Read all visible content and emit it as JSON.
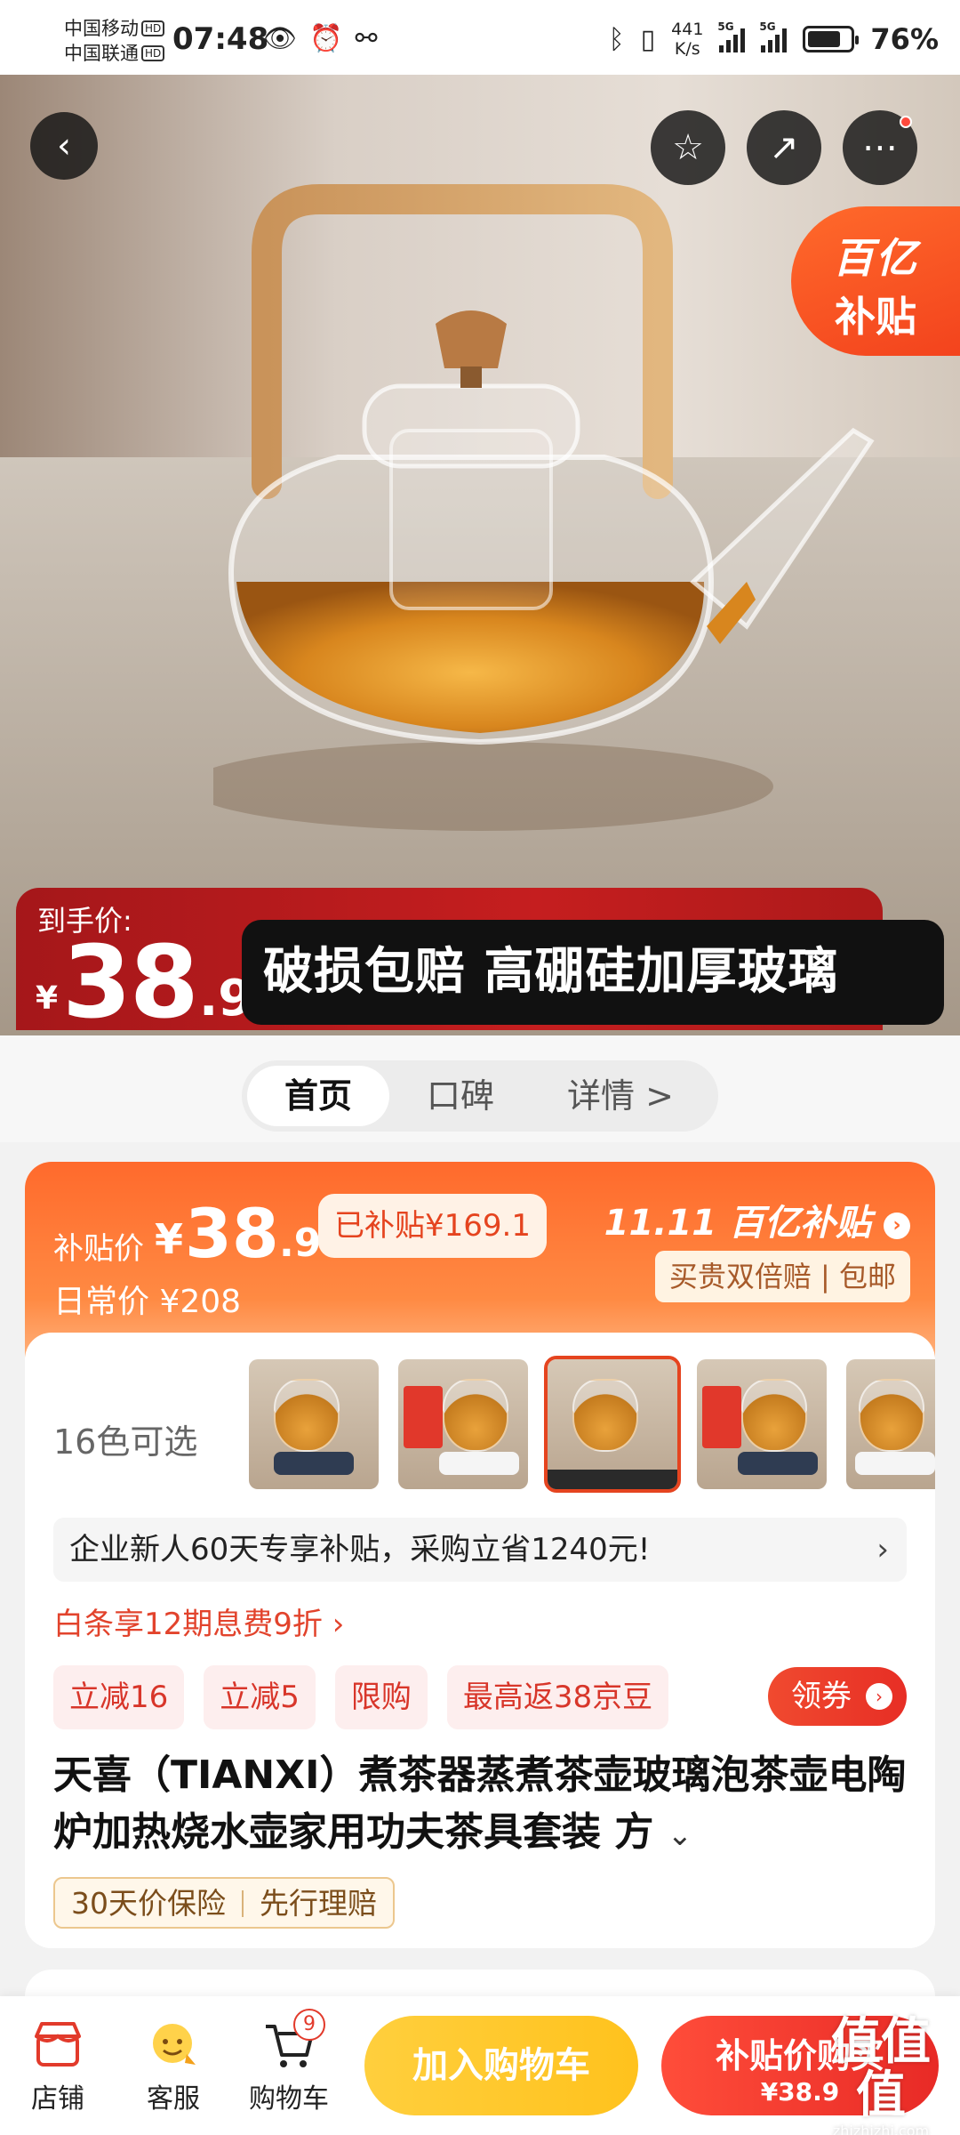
{
  "status_bar": {
    "carrier1": "中国移动",
    "carrier2": "中国联通",
    "hd": "HD",
    "time": "07:48",
    "net_speed_value": "441",
    "net_speed_unit": "K/s",
    "sig_tag": "5G",
    "battery_pct": "76%"
  },
  "hero": {
    "badge_line1": "百亿",
    "badge_line2": "补贴",
    "price_label": "到手价:",
    "price_yen": "¥",
    "price_int": "38",
    "price_dec": ".9",
    "slogan": "破损包赔 高硼硅加厚玻璃"
  },
  "tabs": [
    {
      "label": "首页",
      "active": true
    },
    {
      "label": "口碑",
      "active": false
    },
    {
      "label": "详情 >",
      "active": false
    }
  ],
  "subsidy": {
    "label": "补贴价",
    "yen": "¥",
    "price_int": "38",
    "price_dec": ".9",
    "already": "已补贴¥169.1",
    "daily": "日常价 ¥208",
    "brand": "11.11 百亿补贴",
    "guarantee": "买贵双倍赔 | 包邮"
  },
  "variants": {
    "label": "16色可选"
  },
  "promo": {
    "text": "企业新人60天专享补贴，采购立省1240元!",
    "chevron": "›"
  },
  "baitiao": "白条享12期息费9折 ›",
  "coupons": {
    "chips": [
      "立减16",
      "立减5",
      "限购",
      "最高返38京豆"
    ],
    "get_label": "领券"
  },
  "product": {
    "title": "天喜（TIANXI）煮茶器蒸煮茶壶玻璃泡茶壶电陶炉加热烧水壶家用功夫茶具套装 方",
    "more": "⌄",
    "insure1": "30天价保险",
    "insure2": "先行理赔"
  },
  "bottom": {
    "shop": "店铺",
    "service": "客服",
    "cart": "购物车",
    "cart_count": "9",
    "add_cart": "加入购物车",
    "buy_line1": "补贴价购买",
    "buy_line2": "¥38.9"
  },
  "watermark": {
    "text": "值值值",
    "domain": "zhizhizhi.com"
  },
  "colors": {
    "accent": "#ff6a2c",
    "red": "#e72e25",
    "yellow": "#ffc21d"
  }
}
